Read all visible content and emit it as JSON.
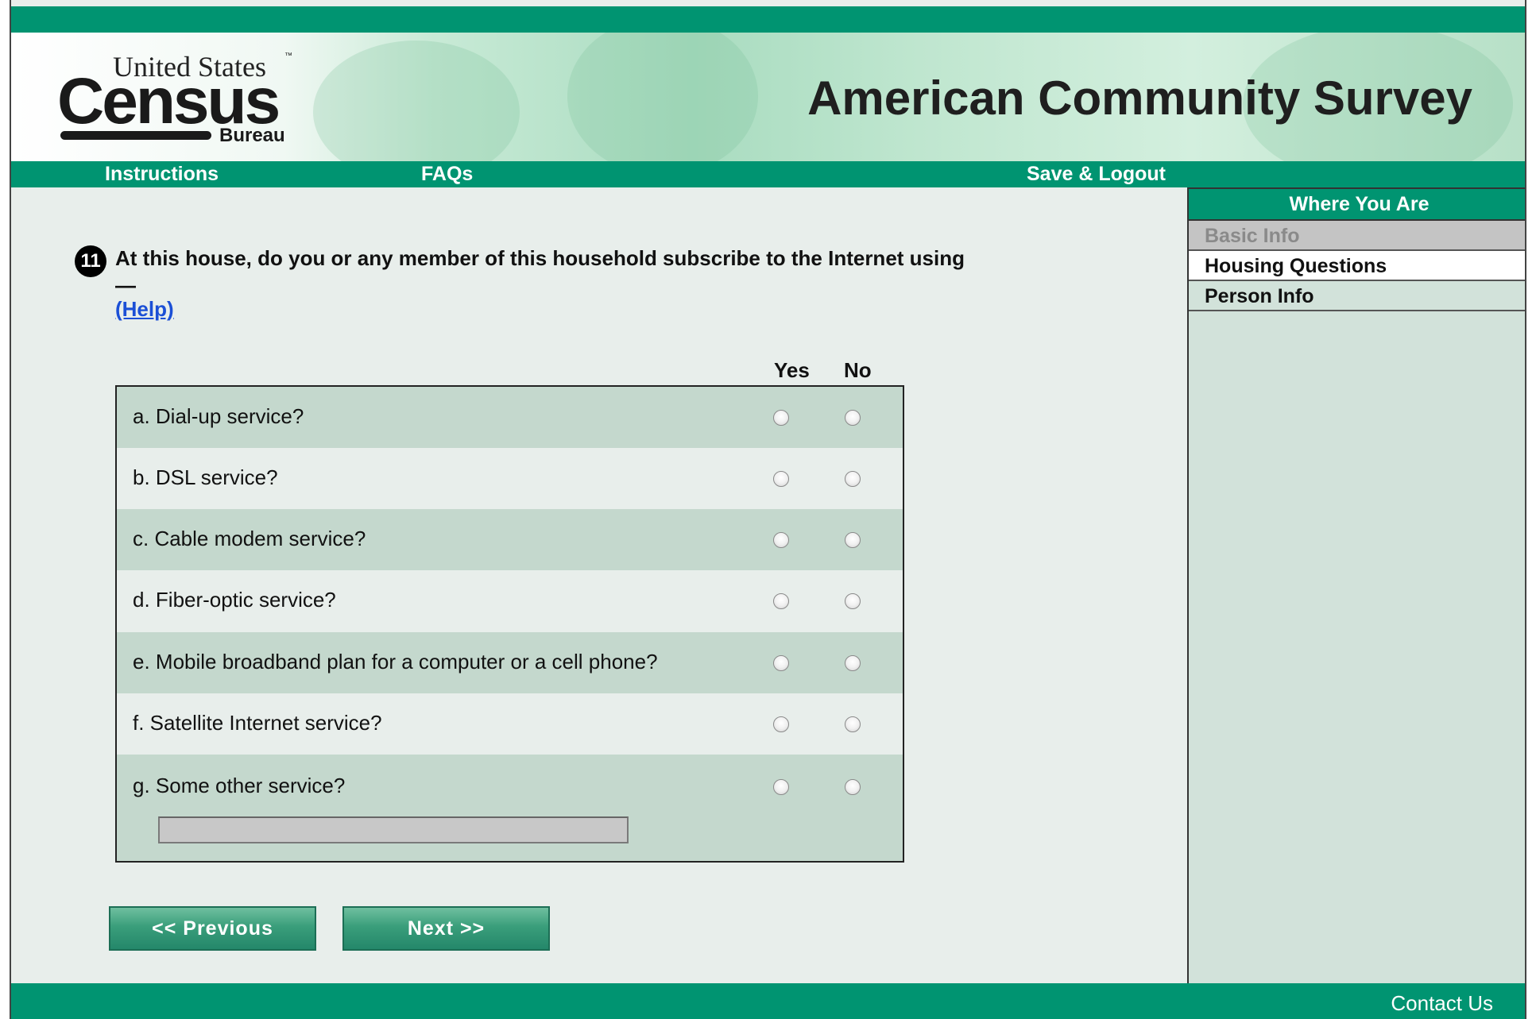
{
  "brand": {
    "logo_top": "United States",
    "logo_tm": "™",
    "logo_main": "Census",
    "logo_sub": "Bureau",
    "title": "American Community Survey"
  },
  "nav": {
    "instructions": "Instructions",
    "faqs": "FAQs",
    "save_logout": "Save & Logout"
  },
  "sidebar": {
    "heading": "Where You Are",
    "items": [
      {
        "label": "Basic Info",
        "state": "disabled"
      },
      {
        "label": "Housing Questions",
        "state": "current"
      },
      {
        "label": "Person Info",
        "state": "normal"
      }
    ]
  },
  "question": {
    "number": "11",
    "text": "At this house, do you or any member of this household subscribe to the Internet using —",
    "help": "(Help)"
  },
  "columns": {
    "yes": "Yes",
    "no": "No"
  },
  "options": [
    {
      "label": "a. Dial-up service?"
    },
    {
      "label": "b. DSL service?"
    },
    {
      "label": "c. Cable modem service?"
    },
    {
      "label": "d. Fiber-optic service?"
    },
    {
      "label": "e. Mobile broadband plan for a computer or a cell phone?"
    },
    {
      "label": "f. Satellite Internet service?"
    },
    {
      "label": "g. Some other service?"
    }
  ],
  "other_input_value": "",
  "buttons": {
    "previous": "<<   Previous",
    "next": "Next   >>"
  },
  "footer": {
    "contact": "Contact Us"
  },
  "colors": {
    "brand_green": "#009471",
    "shade_row": "#c4d8cd",
    "page_bg": "#e8eeeb"
  }
}
